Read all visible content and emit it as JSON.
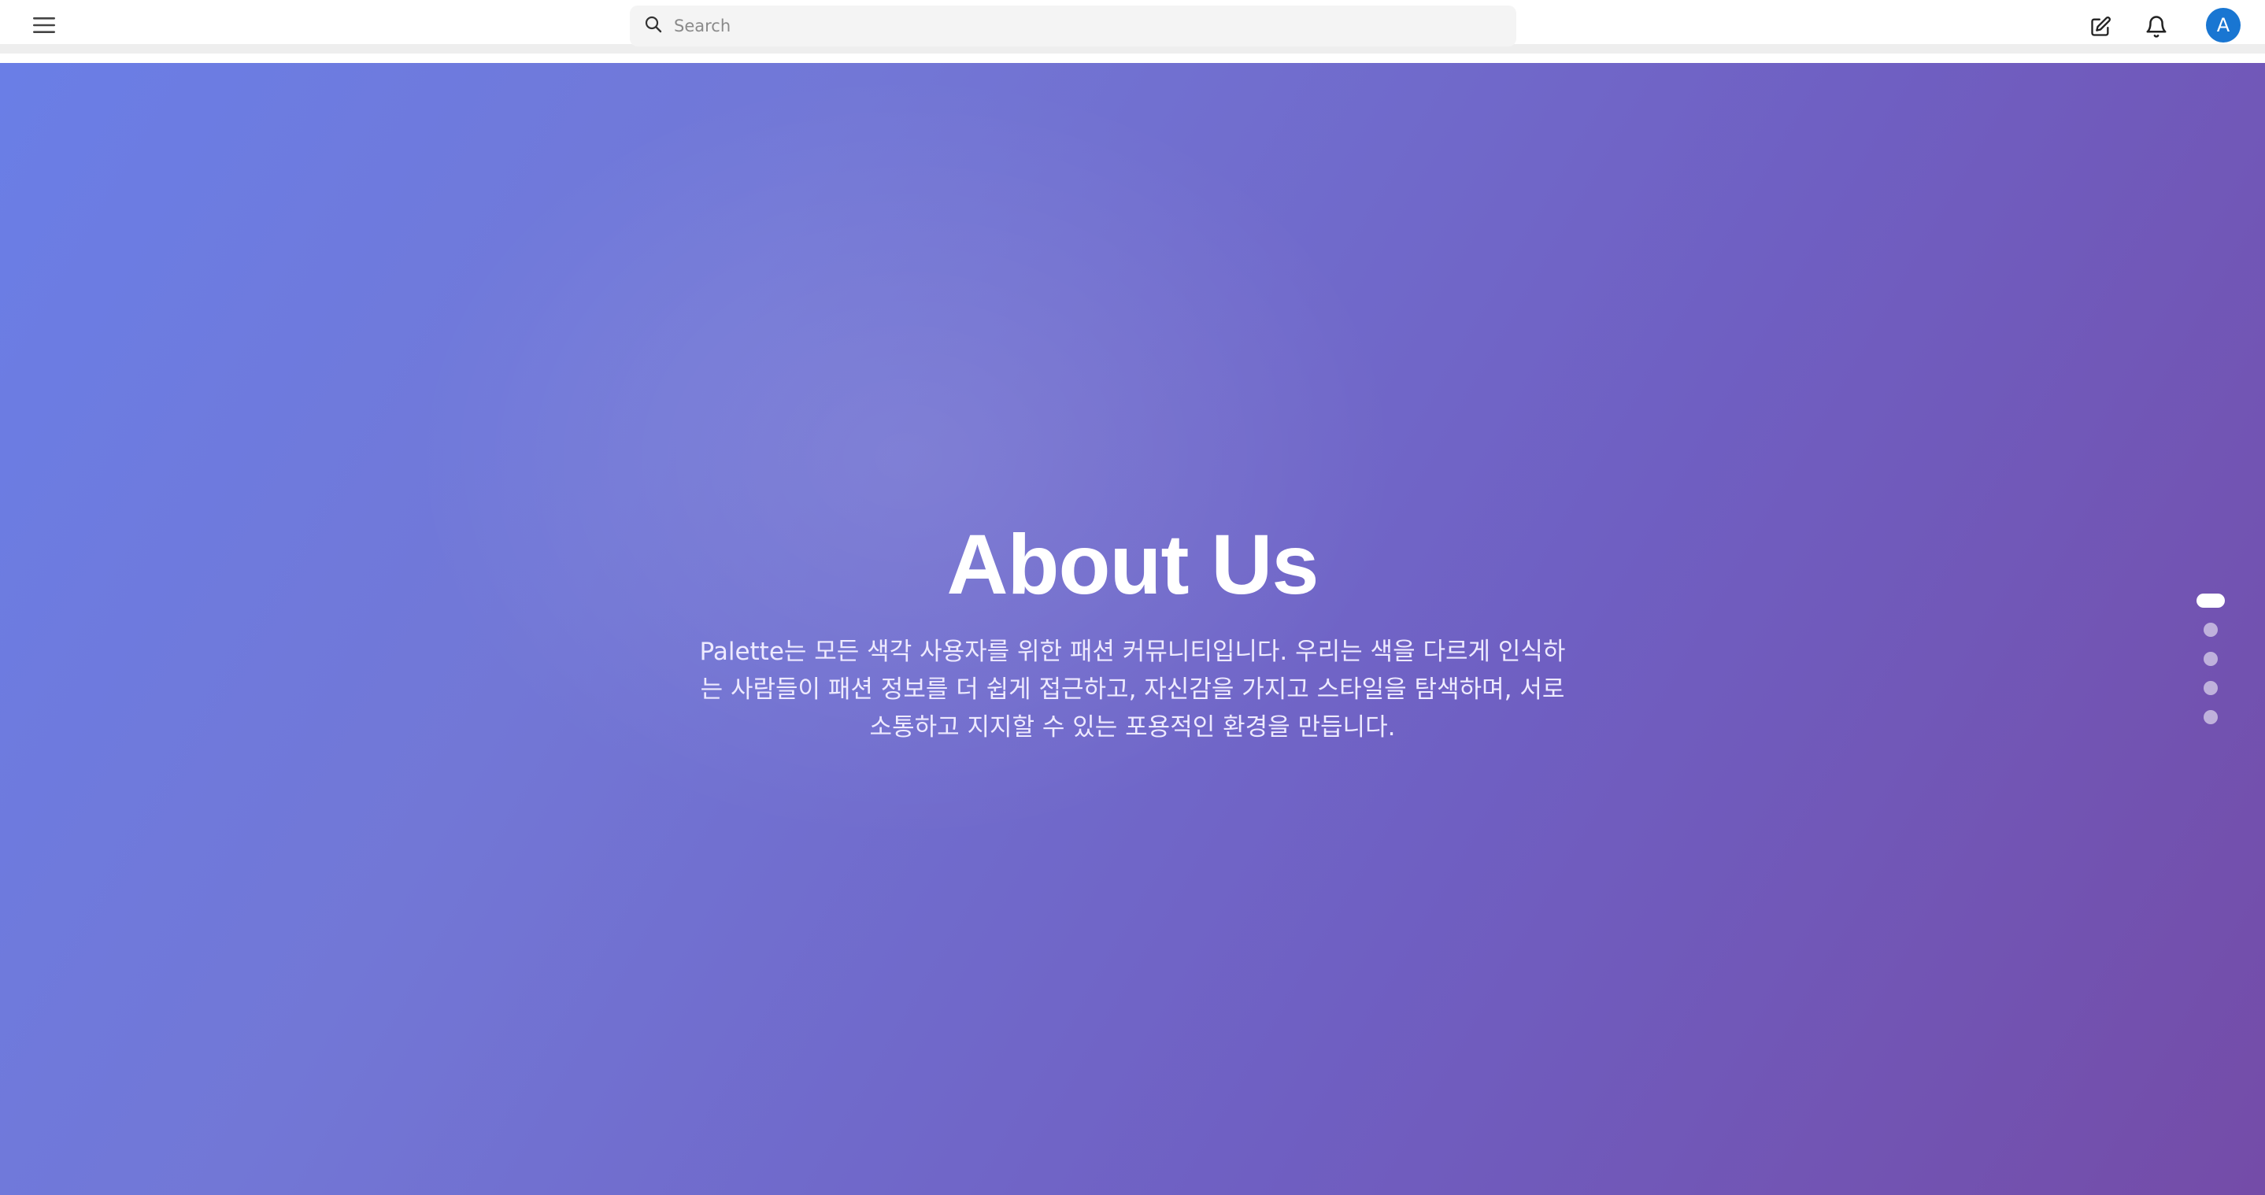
{
  "header": {
    "search_placeholder": "Search",
    "icons": {
      "menu": "hamburger-menu-icon",
      "search": "search-icon",
      "edit": "edit-icon",
      "notifications": "bell-icon"
    },
    "avatar_initial": "A",
    "avatar_color": "#1976d2"
  },
  "hero": {
    "title": "About Us",
    "description": "Palette는 모든 색각 사용자를 위한 패션 커뮤니티입니다. 우리는 색을 다르게 인식하는 사람들이 패션 정보를 더 쉽게 접근하고, 자신감을 가지고 스타일을 탐색하며, 서로 소통하고 지지할 수 있는 포용적인 환경을 만듭니다.",
    "gradient_colors": [
      "#6a7ee6",
      "#7277d6",
      "#6f5fc2",
      "#744ca8"
    ]
  },
  "pagination": {
    "total_sections": 5,
    "active_index": 0
  }
}
